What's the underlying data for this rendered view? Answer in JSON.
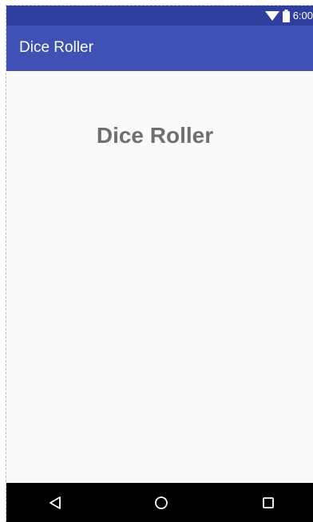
{
  "status_bar": {
    "time": "6:00",
    "background": "#303f9f",
    "icons": [
      "wifi-icon",
      "battery-icon"
    ]
  },
  "app_bar": {
    "title": "Dice Roller",
    "background": "#3f51b5"
  },
  "main": {
    "heading": "Dice Roller",
    "heading_color": "#6f6f6f"
  },
  "nav_bar": {
    "background": "#000000",
    "buttons": [
      "back-icon",
      "home-icon",
      "recents-icon"
    ]
  }
}
